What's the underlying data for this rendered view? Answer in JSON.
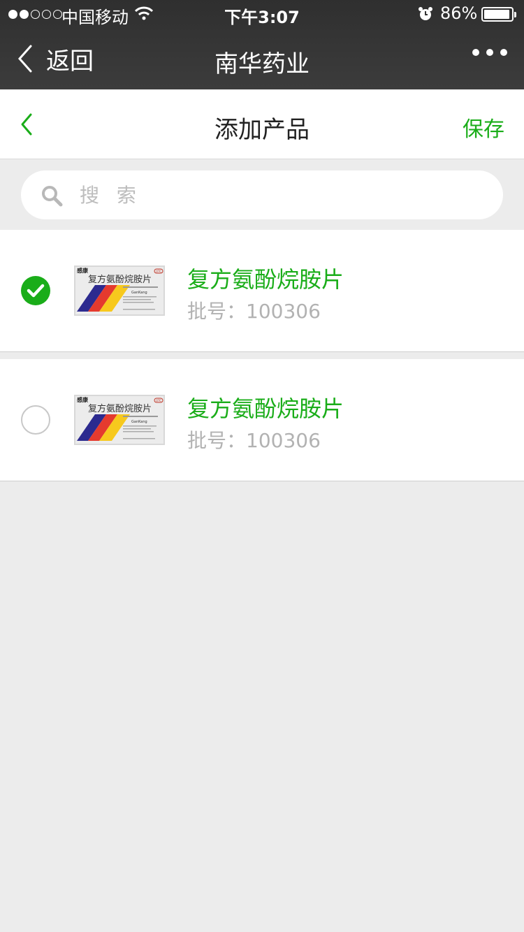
{
  "status_bar": {
    "carrier": "中国移动",
    "time": "下午3:07",
    "battery": "86%",
    "battery_level": 0.86,
    "signal_strength": 2
  },
  "nav": {
    "back_label": "返回",
    "title": "南华药业"
  },
  "page": {
    "title": "添加产品",
    "save_label": "保存"
  },
  "search": {
    "placeholder": "搜 索",
    "value": ""
  },
  "products": [
    {
      "name": "复方氨酚烷胺片",
      "batch_label": "批号：100306",
      "selected": true
    },
    {
      "name": "复方氨酚烷胺片",
      "batch_label": "批号：100306",
      "selected": false
    }
  ],
  "package_art": {
    "brand": "感康",
    "name": "复方氨酚烷胺片",
    "badge": "OTC",
    "romanized": "GanKang"
  },
  "colors": {
    "accent": "#1aad19",
    "muted": "#b2b2b2",
    "background": "#ececec",
    "topbar": "#353535"
  },
  "icons": {
    "back": "chevron-left-icon",
    "more": "more-dots-icon",
    "search": "search-icon",
    "checked": "check-circle-icon",
    "unchecked": "empty-circle-icon"
  }
}
